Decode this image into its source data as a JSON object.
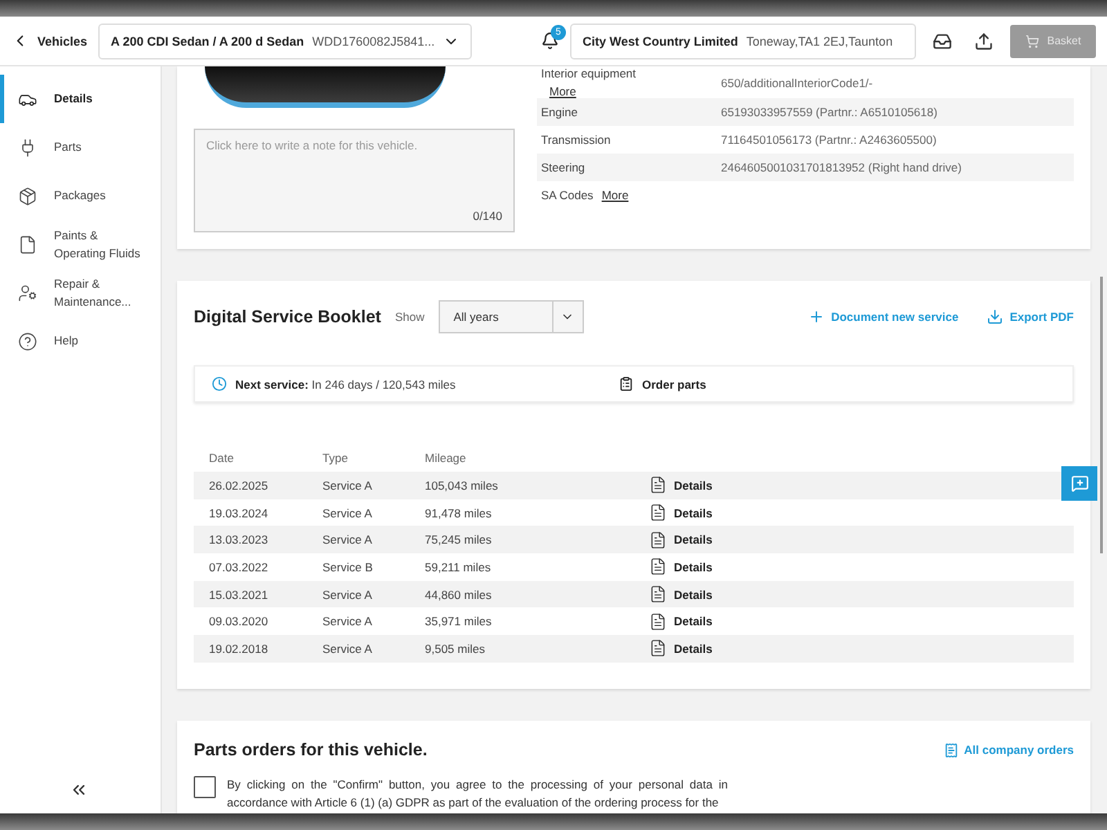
{
  "header": {
    "back_label": "Vehicles",
    "vehicle": {
      "model": "A 200 CDI Sedan / A 200 d Sedan",
      "vin": "WDD1760082J5841..."
    },
    "notifications": {
      "count": "5"
    },
    "dealer": {
      "name": "City West Country Limited",
      "address": "Toneway,TA1 2EJ,Taunton"
    },
    "basket": {
      "label": "Basket",
      "disabled": true
    }
  },
  "sidebar": {
    "items": [
      {
        "label": "Details",
        "selected": true
      },
      {
        "label": "Parts",
        "selected": false
      },
      {
        "label": "Packages",
        "selected": false
      },
      {
        "label": "Paints & Operating Fluids",
        "selected": false
      },
      {
        "label": "Repair & Maintenance...",
        "selected": false
      },
      {
        "label": "Help",
        "selected": false
      }
    ]
  },
  "vehicle_details": {
    "note": {
      "placeholder": "Click here to write a note for this vehicle.",
      "counter": "0/140"
    },
    "specs": [
      {
        "kind": "stacked",
        "label": "Interior equipment",
        "link": "More",
        "value": "650/additionalInteriorCode1/-"
      },
      {
        "kind": "plain",
        "label": "Engine",
        "value": "65193033957559 (Partnr.: A6510105618)"
      },
      {
        "kind": "plain",
        "label": "Transmission",
        "value": "71164501056173 (Partnr.: A2463605500)"
      },
      {
        "kind": "plain",
        "label": "Steering",
        "value": "24646050010317018139​52 (Right hand drive)"
      },
      {
        "kind": "inline",
        "label": "SA Codes",
        "link": "More"
      }
    ]
  },
  "service_booklet": {
    "title": "Digital Service Booklet",
    "show_label": "Show",
    "filter": "All years",
    "actions": [
      {
        "kind": "add",
        "label": "Document new service"
      },
      {
        "kind": "export",
        "label": "Export PDF"
      }
    ],
    "next_service": "**Next service:** In 246 days / 120,543 miles",
    "order_parts": "Order parts",
    "columns": [
      "Date",
      "Type",
      "Mileage"
    ],
    "rows": [
      {
        "date": "26.02.2025",
        "type": "Service A",
        "mileage": "105,043 miles",
        "details": "Details"
      },
      {
        "date": "19.03.2024",
        "type": "Service A",
        "mileage": "91,478 miles",
        "details": "Details"
      },
      {
        "date": "13.03.2023",
        "type": "Service A",
        "mileage": "75,245 miles",
        "details": "Details"
      },
      {
        "date": "07.03.2022",
        "type": "Service B",
        "mileage": "59,211 miles",
        "details": "Details"
      },
      {
        "date": "15.03.2021",
        "type": "Service A",
        "mileage": "44,860 miles",
        "details": "Details"
      },
      {
        "date": "09.03.2020",
        "type": "Service A",
        "mileage": "35,971 miles",
        "details": "Details"
      },
      {
        "date": "19.02.2018",
        "type": "Service A",
        "mileage": "9,505 miles",
        "details": "Details"
      }
    ]
  },
  "parts_orders": {
    "title": "Parts orders for this vehicle.",
    "link": "All company orders",
    "consent": {
      "checked": false,
      "text": "By clicking on the \"Confirm\" button, you agree to the processing of your personal data in accordance with Article 6 (1) (a) GDPR as part of the evaluation of the ordering process for the"
    }
  }
}
